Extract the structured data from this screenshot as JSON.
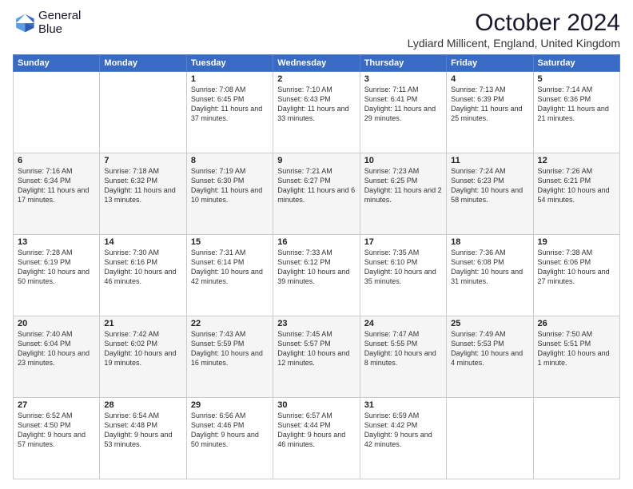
{
  "header": {
    "logo_line1": "General",
    "logo_line2": "Blue",
    "month": "October 2024",
    "location": "Lydiard Millicent, England, United Kingdom"
  },
  "days": [
    "Sunday",
    "Monday",
    "Tuesday",
    "Wednesday",
    "Thursday",
    "Friday",
    "Saturday"
  ],
  "weeks": [
    [
      {
        "day": "",
        "text": ""
      },
      {
        "day": "",
        "text": ""
      },
      {
        "day": "1",
        "text": "Sunrise: 7:08 AM\nSunset: 6:45 PM\nDaylight: 11 hours and 37 minutes."
      },
      {
        "day": "2",
        "text": "Sunrise: 7:10 AM\nSunset: 6:43 PM\nDaylight: 11 hours and 33 minutes."
      },
      {
        "day": "3",
        "text": "Sunrise: 7:11 AM\nSunset: 6:41 PM\nDaylight: 11 hours and 29 minutes."
      },
      {
        "day": "4",
        "text": "Sunrise: 7:13 AM\nSunset: 6:39 PM\nDaylight: 11 hours and 25 minutes."
      },
      {
        "day": "5",
        "text": "Sunrise: 7:14 AM\nSunset: 6:36 PM\nDaylight: 11 hours and 21 minutes."
      }
    ],
    [
      {
        "day": "6",
        "text": "Sunrise: 7:16 AM\nSunset: 6:34 PM\nDaylight: 11 hours and 17 minutes."
      },
      {
        "day": "7",
        "text": "Sunrise: 7:18 AM\nSunset: 6:32 PM\nDaylight: 11 hours and 13 minutes."
      },
      {
        "day": "8",
        "text": "Sunrise: 7:19 AM\nSunset: 6:30 PM\nDaylight: 11 hours and 10 minutes."
      },
      {
        "day": "9",
        "text": "Sunrise: 7:21 AM\nSunset: 6:27 PM\nDaylight: 11 hours and 6 minutes."
      },
      {
        "day": "10",
        "text": "Sunrise: 7:23 AM\nSunset: 6:25 PM\nDaylight: 11 hours and 2 minutes."
      },
      {
        "day": "11",
        "text": "Sunrise: 7:24 AM\nSunset: 6:23 PM\nDaylight: 10 hours and 58 minutes."
      },
      {
        "day": "12",
        "text": "Sunrise: 7:26 AM\nSunset: 6:21 PM\nDaylight: 10 hours and 54 minutes."
      }
    ],
    [
      {
        "day": "13",
        "text": "Sunrise: 7:28 AM\nSunset: 6:19 PM\nDaylight: 10 hours and 50 minutes."
      },
      {
        "day": "14",
        "text": "Sunrise: 7:30 AM\nSunset: 6:16 PM\nDaylight: 10 hours and 46 minutes."
      },
      {
        "day": "15",
        "text": "Sunrise: 7:31 AM\nSunset: 6:14 PM\nDaylight: 10 hours and 42 minutes."
      },
      {
        "day": "16",
        "text": "Sunrise: 7:33 AM\nSunset: 6:12 PM\nDaylight: 10 hours and 39 minutes."
      },
      {
        "day": "17",
        "text": "Sunrise: 7:35 AM\nSunset: 6:10 PM\nDaylight: 10 hours and 35 minutes."
      },
      {
        "day": "18",
        "text": "Sunrise: 7:36 AM\nSunset: 6:08 PM\nDaylight: 10 hours and 31 minutes."
      },
      {
        "day": "19",
        "text": "Sunrise: 7:38 AM\nSunset: 6:06 PM\nDaylight: 10 hours and 27 minutes."
      }
    ],
    [
      {
        "day": "20",
        "text": "Sunrise: 7:40 AM\nSunset: 6:04 PM\nDaylight: 10 hours and 23 minutes."
      },
      {
        "day": "21",
        "text": "Sunrise: 7:42 AM\nSunset: 6:02 PM\nDaylight: 10 hours and 19 minutes."
      },
      {
        "day": "22",
        "text": "Sunrise: 7:43 AM\nSunset: 5:59 PM\nDaylight: 10 hours and 16 minutes."
      },
      {
        "day": "23",
        "text": "Sunrise: 7:45 AM\nSunset: 5:57 PM\nDaylight: 10 hours and 12 minutes."
      },
      {
        "day": "24",
        "text": "Sunrise: 7:47 AM\nSunset: 5:55 PM\nDaylight: 10 hours and 8 minutes."
      },
      {
        "day": "25",
        "text": "Sunrise: 7:49 AM\nSunset: 5:53 PM\nDaylight: 10 hours and 4 minutes."
      },
      {
        "day": "26",
        "text": "Sunrise: 7:50 AM\nSunset: 5:51 PM\nDaylight: 10 hours and 1 minute."
      }
    ],
    [
      {
        "day": "27",
        "text": "Sunrise: 6:52 AM\nSunset: 4:50 PM\nDaylight: 9 hours and 57 minutes."
      },
      {
        "day": "28",
        "text": "Sunrise: 6:54 AM\nSunset: 4:48 PM\nDaylight: 9 hours and 53 minutes."
      },
      {
        "day": "29",
        "text": "Sunrise: 6:56 AM\nSunset: 4:46 PM\nDaylight: 9 hours and 50 minutes."
      },
      {
        "day": "30",
        "text": "Sunrise: 6:57 AM\nSunset: 4:44 PM\nDaylight: 9 hours and 46 minutes."
      },
      {
        "day": "31",
        "text": "Sunrise: 6:59 AM\nSunset: 4:42 PM\nDaylight: 9 hours and 42 minutes."
      },
      {
        "day": "",
        "text": ""
      },
      {
        "day": "",
        "text": ""
      }
    ]
  ]
}
